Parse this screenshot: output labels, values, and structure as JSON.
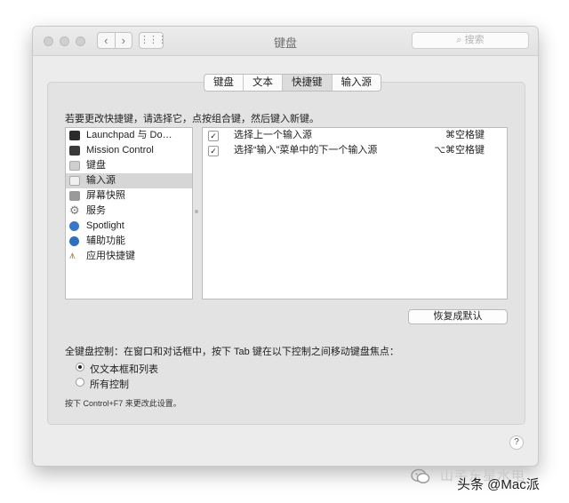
{
  "window": {
    "title": "键盘",
    "search_placeholder": "搜索",
    "nav_back": "‹",
    "nav_forward": "›",
    "grid": "⋮⋮⋮"
  },
  "tabs": [
    {
      "label": "键盘",
      "active": false
    },
    {
      "label": "文本",
      "active": false
    },
    {
      "label": "快捷键",
      "active": true
    },
    {
      "label": "输入源",
      "active": false
    }
  ],
  "instruction": "若要更改快捷键，请选择它，点按组合键，然后键入新键。",
  "categories": [
    {
      "label": "Launchpad 与 Do…",
      "icon": "launchpad-icon",
      "color": "#2b2b2b",
      "selected": false
    },
    {
      "label": "Mission Control",
      "icon": "mission-control-icon",
      "color": "#3a3a3a",
      "selected": false
    },
    {
      "label": "键盘",
      "icon": "keyboard-icon",
      "color": "#cfcfcf",
      "selected": false
    },
    {
      "label": "输入源",
      "icon": "input-source-icon",
      "color": "#dadada",
      "selected": true
    },
    {
      "label": "屏幕快照",
      "icon": "screenshot-icon",
      "color": "#9a9a9a",
      "selected": false
    },
    {
      "label": "服务",
      "icon": "services-gear-icon",
      "color": "#8c8c8c",
      "selected": false
    },
    {
      "label": "Spotlight",
      "icon": "spotlight-icon",
      "color": "#3b78c4",
      "selected": false
    },
    {
      "label": "辅助功能",
      "icon": "accessibility-icon",
      "color": "#2f6fc0",
      "selected": false
    },
    {
      "label": "应用快捷键",
      "icon": "app-shortcuts-icon",
      "color": "#b08a4a",
      "selected": false
    }
  ],
  "shortcuts": [
    {
      "checked": true,
      "label": "选择上一个输入源",
      "key": "⌘空格键"
    },
    {
      "checked": true,
      "label": "选择“输入”菜单中的下一个输入源",
      "key": "⌥⌘空格键"
    }
  ],
  "restore_button": "恢复成默认",
  "keyboard_control": {
    "label": "全键盘控制：在窗口和对话框中，按下 Tab 键在以下控制之间移动键盘焦点：",
    "options": [
      {
        "label": "仅文本框和列表",
        "selected": true
      },
      {
        "label": "所有控制",
        "selected": false
      }
    ],
    "note": "按下 Control+F7 来更改此设置。"
  },
  "help": "?",
  "watermark": {
    "text": "头条 @Mac派",
    "faint": "山芊东星水电"
  }
}
